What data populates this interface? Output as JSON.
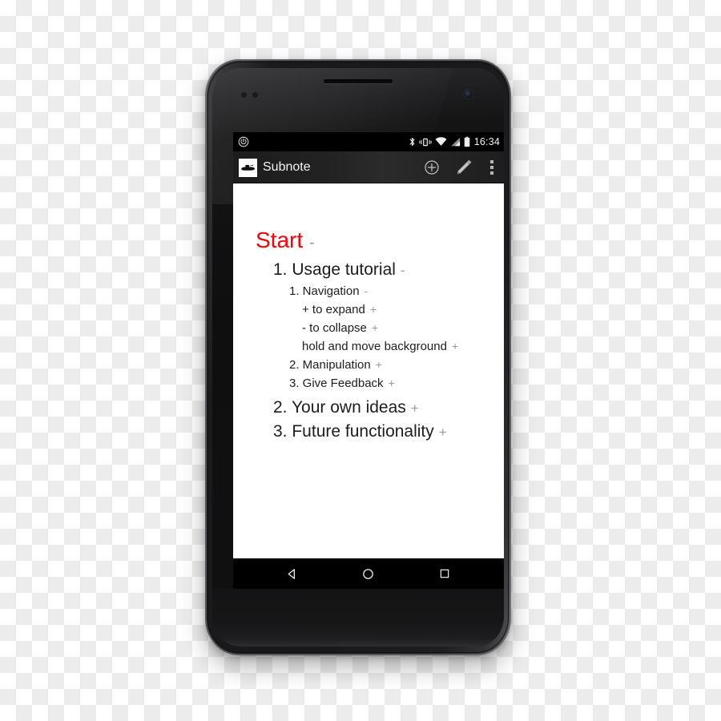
{
  "device": {
    "name": "android-smartphone",
    "speaker": "earpiece-speaker-grille",
    "camera": "front-camera"
  },
  "status_bar": {
    "notification_icon": "power-icon",
    "icons": [
      "bluetooth-icon",
      "vibrate-icon",
      "wifi-icon",
      "signal-icon",
      "battery-icon"
    ],
    "clock": "16:34"
  },
  "action_bar": {
    "logo": "submarine-logo-icon",
    "title": "Subnote",
    "actions": [
      {
        "name": "add-node-button",
        "icon": "plus-circle-icon"
      },
      {
        "name": "edit-button",
        "icon": "pencil-icon"
      },
      {
        "name": "overflow-menu-button",
        "icon": "three-dots-icon"
      }
    ]
  },
  "note": {
    "nodes": [
      {
        "level": "root",
        "text": "Start",
        "marker": "-"
      },
      {
        "level": "1",
        "text": "1. Usage tutorial",
        "marker": "-"
      },
      {
        "level": "2",
        "text": "1. Navigation",
        "marker": "-"
      },
      {
        "level": "3",
        "text": "+ to expand",
        "marker": "+"
      },
      {
        "level": "3",
        "text": "- to collapse",
        "marker": "+"
      },
      {
        "level": "3",
        "text": "hold and move background",
        "marker": "+"
      },
      {
        "level": "2",
        "text": "2. Manipulation",
        "marker": "+"
      },
      {
        "level": "2",
        "text": "3. Give Feedback",
        "marker": "+"
      },
      {
        "level": "1",
        "text": "2. Your own ideas",
        "marker": "+"
      },
      {
        "level": "1",
        "text": "3. Future functionality",
        "marker": "+"
      }
    ]
  },
  "nav_bar": {
    "buttons": [
      {
        "name": "back-button",
        "icon": "triangle-left-icon"
      },
      {
        "name": "home-button",
        "icon": "circle-icon"
      },
      {
        "name": "recents-button",
        "icon": "square-icon"
      }
    ]
  },
  "colors": {
    "root_node_text": "#fb0007",
    "node_text": "#1d1d1d",
    "marker": "#9a9a9a",
    "screen_background": "#ffffff",
    "action_bar": "#232323",
    "status_bar": "#000000"
  }
}
